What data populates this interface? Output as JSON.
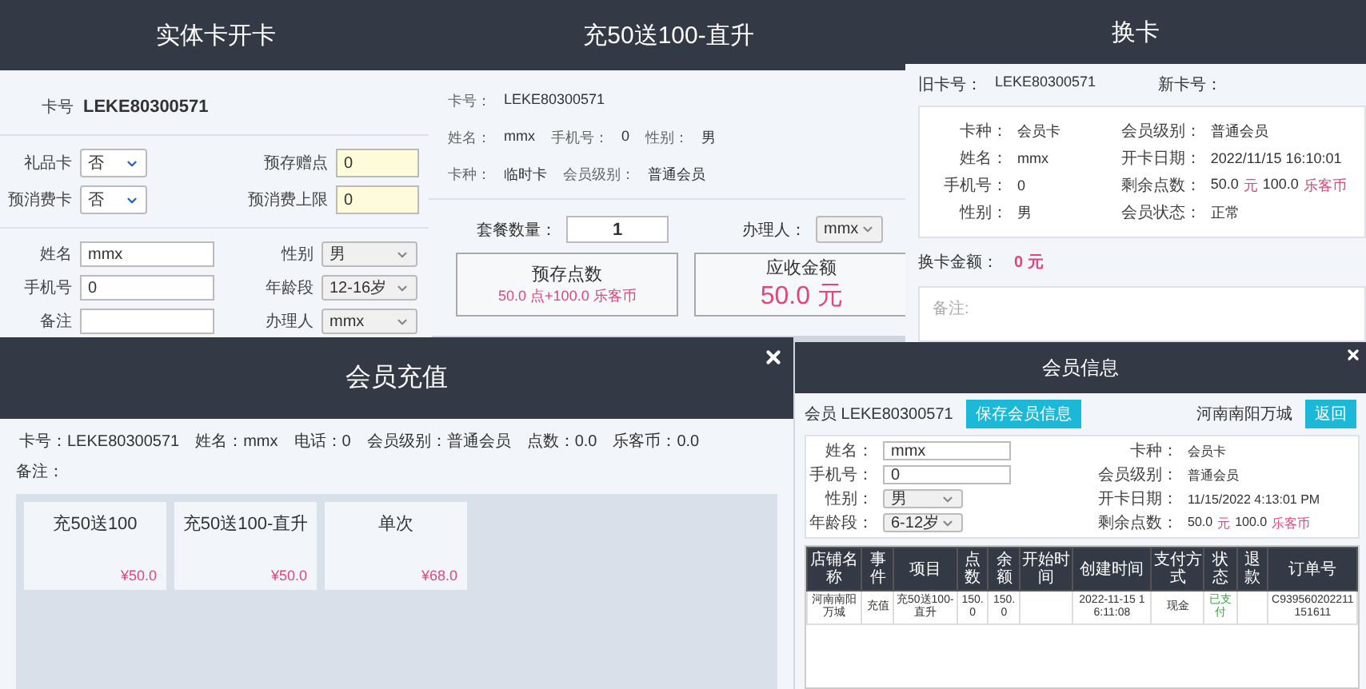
{
  "open_card": {
    "title": "实体卡开卡",
    "card_label": "卡号",
    "card_no": "LEKE80300571",
    "section_1": [
      {
        "label": "礼品卡",
        "value": "否",
        "kind": "select"
      },
      {
        "label": "预存赠点",
        "value": "0",
        "kind": "highlight"
      },
      {
        "label": "预消费卡",
        "value": "否",
        "kind": "select"
      },
      {
        "label": "预消费上限",
        "value": "0",
        "kind": "highlight"
      }
    ],
    "section_2": [
      {
        "label": "姓名",
        "value": "mmx",
        "kind": "input"
      },
      {
        "label": "性别",
        "value": "男",
        "kind": "dropdown"
      },
      {
        "label": "手机号",
        "value": "0",
        "kind": "input"
      },
      {
        "label": "年龄段",
        "value": "12-16岁",
        "kind": "dropdown"
      },
      {
        "label": "备注",
        "kind": "input"
      },
      {
        "label": "办理人",
        "value": "mmx",
        "kind": "dropdown"
      }
    ]
  },
  "package_recharge": {
    "title": "充50送100-直升",
    "info_rows": [
      [
        {
          "label": "卡号：",
          "value": "LEKE80300571"
        }
      ],
      [
        {
          "label": "姓名：",
          "value": "mmx"
        },
        {
          "label": "手机号：",
          "value": "0"
        },
        {
          "label": "性别：",
          "value": "男"
        }
      ],
      [
        {
          "label": "卡种：",
          "value": "临时卡"
        },
        {
          "label": "会员级别：",
          "value": "普通会员"
        }
      ]
    ],
    "quantity": {
      "label": "套餐数量：",
      "value": "1"
    },
    "handler": {
      "label": "办理人：",
      "value": "mmx"
    },
    "points_box": {
      "title": "预存点数",
      "value": "50.0 点+100.0 乐客币"
    },
    "amount_box": {
      "title": "应收金额",
      "value": "50.0 元"
    }
  },
  "card_exchange": {
    "title": "换卡",
    "old_card": {
      "label": "旧卡号：",
      "value": "LEKE80300571"
    },
    "new_card": {
      "label": "新卡号："
    },
    "left": [
      {
        "label": "卡种：",
        "parts": [
          {
            "text": "会员卡",
            "accent": false
          }
        ]
      },
      {
        "label": "姓名：",
        "parts": [
          {
            "text": "mmx",
            "accent": false
          }
        ]
      },
      {
        "label": "手机号：",
        "parts": [
          {
            "text": "0",
            "accent": false
          }
        ]
      },
      {
        "label": "性别：",
        "parts": [
          {
            "text": "男",
            "accent": false
          }
        ]
      }
    ],
    "right": [
      {
        "label": "会员级别：",
        "parts": [
          {
            "text": "普通会员",
            "accent": false
          }
        ]
      },
      {
        "label": "开卡日期：",
        "parts": [
          {
            "text": "2022/11/15 16:10:01",
            "accent": false
          }
        ]
      },
      {
        "label": "剩余点数：",
        "parts": [
          {
            "text": "50.0",
            "accent": false
          },
          {
            "text": "元",
            "accent": true
          },
          {
            "text": "100.0",
            "accent": false
          },
          {
            "text": "乐客币",
            "accent": true
          }
        ]
      },
      {
        "label": "会员状态：",
        "parts": [
          {
            "text": "正常",
            "accent": false
          }
        ]
      }
    ],
    "amount": {
      "label": "换卡金额：",
      "value": "0  元"
    },
    "remark": {
      "placeholder": "备注:"
    }
  },
  "member_recharge": {
    "title": "会员充值",
    "info": [
      {
        "label": "卡号：",
        "value": "LEKE80300571"
      },
      {
        "label": "姓名：",
        "value": "mmx"
      },
      {
        "label": "电话：",
        "value": "0"
      },
      {
        "label": "会员级别：",
        "value": "普通会员"
      },
      {
        "label": "点数：",
        "value": "0.0"
      },
      {
        "label": "乐客币：",
        "value": "0.0"
      }
    ],
    "remark_label": "备注：",
    "packages": [
      {
        "name": "充50送100",
        "price": "¥50.0"
      },
      {
        "name": "充50送100-直升",
        "price": "¥50.0"
      },
      {
        "name": "单次",
        "price": "¥68.0"
      }
    ]
  },
  "member_info": {
    "title": "会员信息",
    "member": "会员 LEKE80300571",
    "save_button": "保存会员信息",
    "store": "河南南阳万城",
    "back_button": "返回",
    "left": [
      {
        "label": "姓名：",
        "value": "mmx",
        "kind": "input"
      },
      {
        "label": "手机号：",
        "value": "0",
        "kind": "input"
      },
      {
        "label": "性别：",
        "value": "男",
        "kind": "dropdown"
      },
      {
        "label": "年龄段：",
        "value": "6-12岁",
        "kind": "dropdown"
      }
    ],
    "right": [
      {
        "label": "卡种：",
        "parts": [
          {
            "text": "会员卡",
            "accent": false
          }
        ]
      },
      {
        "label": "会员级别：",
        "parts": [
          {
            "text": "普通会员",
            "accent": false
          }
        ]
      },
      {
        "label": "开卡日期：",
        "parts": [
          {
            "text": "11/15/2022 4:13:01 PM",
            "accent": false
          }
        ]
      },
      {
        "label": "剩余点数：",
        "parts": [
          {
            "text": "50.0",
            "accent": false
          },
          {
            "text": "元",
            "accent": true
          },
          {
            "text": "100.0",
            "accent": false
          },
          {
            "text": "乐客币",
            "accent": true
          }
        ]
      }
    ],
    "table": {
      "columns": [
        "店铺名称",
        "事件",
        "项目",
        "点数",
        "余额",
        "开始时间",
        "创建时间",
        "支付方式",
        "状态",
        "退款",
        "订单号"
      ],
      "rows": [
        {
          "cells": [
            {
              "text": "河南南阳万城",
              "kind": "plain"
            },
            {
              "text": "充值",
              "kind": "plain"
            },
            {
              "text": "充50送100-直升",
              "kind": "plain"
            },
            {
              "text": "150.0",
              "kind": "plain"
            },
            {
              "text": "150.0",
              "kind": "plain"
            },
            {
              "kind": "plain"
            },
            {
              "text": "2022-11-15 16:11:08",
              "kind": "plain"
            },
            {
              "text": "现金",
              "kind": "plain"
            },
            {
              "text": "已支付",
              "kind": "status"
            },
            {
              "kind": "plain"
            },
            {
              "text": "C939560202211151611",
              "kind": "plain"
            }
          ]
        }
      ]
    }
  }
}
